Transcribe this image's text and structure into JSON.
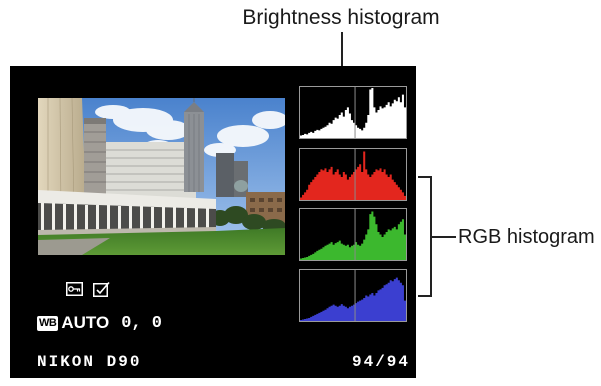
{
  "annotations": {
    "brightness_label": "Brightness histogram",
    "rgb_label": "RGB histogram"
  },
  "screen": {
    "status_icons": [
      "protect-icon",
      "retouch-icon"
    ],
    "white_balance": {
      "badge": "WB",
      "mode": "AUTO",
      "fine_tune": "0, 0"
    },
    "camera_model": "NIKON D90",
    "frame_counter": "94/94"
  },
  "histogram_colors": {
    "brightness": "#ffffff",
    "red": "#e3261e",
    "green": "#3cb82e",
    "blue": "#3b3fd0"
  },
  "colors": {
    "screen_background": "#000000",
    "histogram_border": "#9a9a9a"
  }
}
